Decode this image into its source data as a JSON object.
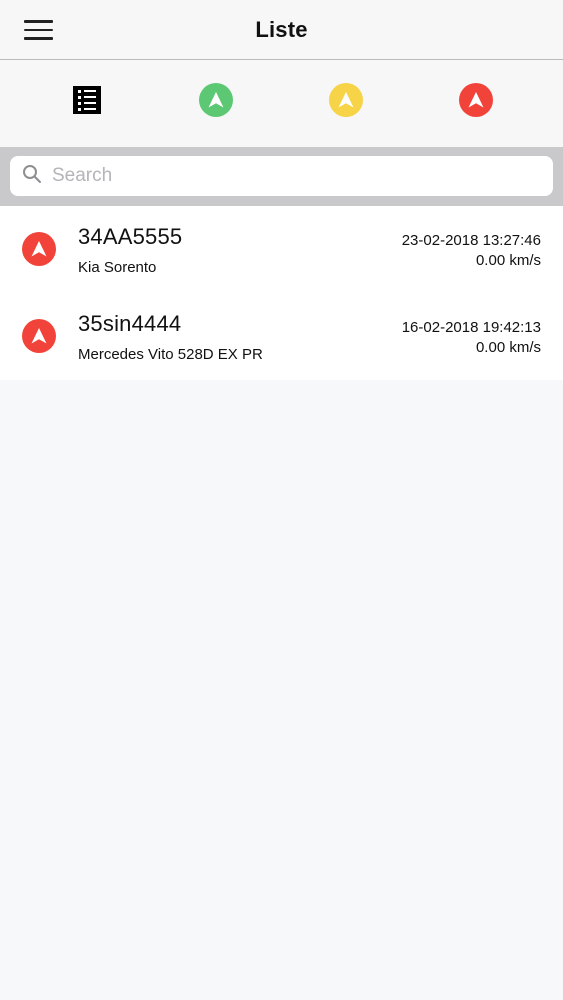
{
  "header": {
    "title": "Liste",
    "menu_icon": "hamburger-menu-icon"
  },
  "filters": [
    {
      "name": "all",
      "icon": "list-icon",
      "color": "#000000"
    },
    {
      "name": "moving",
      "icon": "navigation-arrow-icon",
      "color": "#5cc873"
    },
    {
      "name": "idle",
      "icon": "navigation-arrow-icon",
      "color": "#f7d347"
    },
    {
      "name": "stopped",
      "icon": "navigation-arrow-icon",
      "color": "#f2433a"
    }
  ],
  "search": {
    "placeholder": "Search",
    "value": ""
  },
  "vehicles": [
    {
      "plate": "34AA5555",
      "model": "Kia Sorento",
      "timestamp": "23-02-2018 13:27:46",
      "speed": "0.00 km/s",
      "status_color": "#f2433a"
    },
    {
      "plate": "35sin4444",
      "model": "Mercedes Vito 528D EX PR",
      "timestamp": "16-02-2018 19:42:13",
      "speed": "0.00 km/s",
      "status_color": "#f2433a"
    }
  ]
}
